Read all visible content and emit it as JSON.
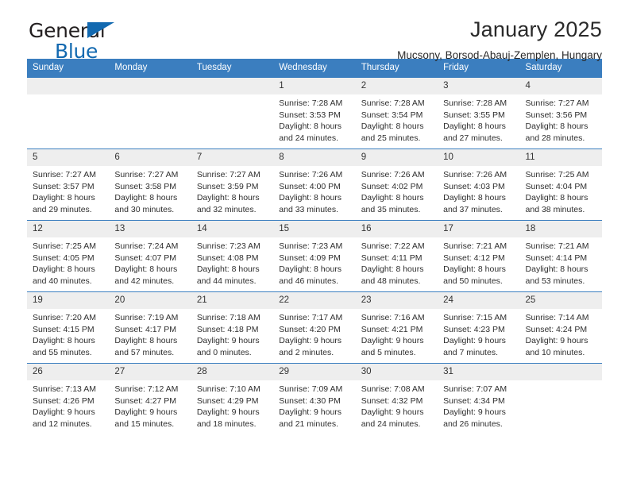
{
  "brand": {
    "line1": "General",
    "line2": "Blue",
    "accent_color": "#1269b0",
    "triangle_icon": "blue-triangle-icon"
  },
  "header": {
    "title": "January 2025",
    "location": "Mucsony, Borsod-Abauj-Zemplen, Hungary"
  },
  "theme": {
    "header_blue": "#3b7ebf",
    "daynum_band": "#eeeeee",
    "text": "#2e2e2e"
  },
  "weekday_headers": [
    "Sunday",
    "Monday",
    "Tuesday",
    "Wednesday",
    "Thursday",
    "Friday",
    "Saturday"
  ],
  "weeks": [
    [
      {
        "day": "",
        "empty": true,
        "sunrise": "",
        "sunset": "",
        "daylight_line1": "",
        "daylight_line2": ""
      },
      {
        "day": "",
        "empty": true,
        "sunrise": "",
        "sunset": "",
        "daylight_line1": "",
        "daylight_line2": ""
      },
      {
        "day": "",
        "empty": true,
        "sunrise": "",
        "sunset": "",
        "daylight_line1": "",
        "daylight_line2": ""
      },
      {
        "day": "1",
        "sunrise": "Sunrise: 7:28 AM",
        "sunset": "Sunset: 3:53 PM",
        "daylight_line1": "Daylight: 8 hours",
        "daylight_line2": "and 24 minutes."
      },
      {
        "day": "2",
        "sunrise": "Sunrise: 7:28 AM",
        "sunset": "Sunset: 3:54 PM",
        "daylight_line1": "Daylight: 8 hours",
        "daylight_line2": "and 25 minutes."
      },
      {
        "day": "3",
        "sunrise": "Sunrise: 7:28 AM",
        "sunset": "Sunset: 3:55 PM",
        "daylight_line1": "Daylight: 8 hours",
        "daylight_line2": "and 27 minutes."
      },
      {
        "day": "4",
        "sunrise": "Sunrise: 7:27 AM",
        "sunset": "Sunset: 3:56 PM",
        "daylight_line1": "Daylight: 8 hours",
        "daylight_line2": "and 28 minutes."
      }
    ],
    [
      {
        "day": "5",
        "sunrise": "Sunrise: 7:27 AM",
        "sunset": "Sunset: 3:57 PM",
        "daylight_line1": "Daylight: 8 hours",
        "daylight_line2": "and 29 minutes."
      },
      {
        "day": "6",
        "sunrise": "Sunrise: 7:27 AM",
        "sunset": "Sunset: 3:58 PM",
        "daylight_line1": "Daylight: 8 hours",
        "daylight_line2": "and 30 minutes."
      },
      {
        "day": "7",
        "sunrise": "Sunrise: 7:27 AM",
        "sunset": "Sunset: 3:59 PM",
        "daylight_line1": "Daylight: 8 hours",
        "daylight_line2": "and 32 minutes."
      },
      {
        "day": "8",
        "sunrise": "Sunrise: 7:26 AM",
        "sunset": "Sunset: 4:00 PM",
        "daylight_line1": "Daylight: 8 hours",
        "daylight_line2": "and 33 minutes."
      },
      {
        "day": "9",
        "sunrise": "Sunrise: 7:26 AM",
        "sunset": "Sunset: 4:02 PM",
        "daylight_line1": "Daylight: 8 hours",
        "daylight_line2": "and 35 minutes."
      },
      {
        "day": "10",
        "sunrise": "Sunrise: 7:26 AM",
        "sunset": "Sunset: 4:03 PM",
        "daylight_line1": "Daylight: 8 hours",
        "daylight_line2": "and 37 minutes."
      },
      {
        "day": "11",
        "sunrise": "Sunrise: 7:25 AM",
        "sunset": "Sunset: 4:04 PM",
        "daylight_line1": "Daylight: 8 hours",
        "daylight_line2": "and 38 minutes."
      }
    ],
    [
      {
        "day": "12",
        "sunrise": "Sunrise: 7:25 AM",
        "sunset": "Sunset: 4:05 PM",
        "daylight_line1": "Daylight: 8 hours",
        "daylight_line2": "and 40 minutes."
      },
      {
        "day": "13",
        "sunrise": "Sunrise: 7:24 AM",
        "sunset": "Sunset: 4:07 PM",
        "daylight_line1": "Daylight: 8 hours",
        "daylight_line2": "and 42 minutes."
      },
      {
        "day": "14",
        "sunrise": "Sunrise: 7:23 AM",
        "sunset": "Sunset: 4:08 PM",
        "daylight_line1": "Daylight: 8 hours",
        "daylight_line2": "and 44 minutes."
      },
      {
        "day": "15",
        "sunrise": "Sunrise: 7:23 AM",
        "sunset": "Sunset: 4:09 PM",
        "daylight_line1": "Daylight: 8 hours",
        "daylight_line2": "and 46 minutes."
      },
      {
        "day": "16",
        "sunrise": "Sunrise: 7:22 AM",
        "sunset": "Sunset: 4:11 PM",
        "daylight_line1": "Daylight: 8 hours",
        "daylight_line2": "and 48 minutes."
      },
      {
        "day": "17",
        "sunrise": "Sunrise: 7:21 AM",
        "sunset": "Sunset: 4:12 PM",
        "daylight_line1": "Daylight: 8 hours",
        "daylight_line2": "and 50 minutes."
      },
      {
        "day": "18",
        "sunrise": "Sunrise: 7:21 AM",
        "sunset": "Sunset: 4:14 PM",
        "daylight_line1": "Daylight: 8 hours",
        "daylight_line2": "and 53 minutes."
      }
    ],
    [
      {
        "day": "19",
        "sunrise": "Sunrise: 7:20 AM",
        "sunset": "Sunset: 4:15 PM",
        "daylight_line1": "Daylight: 8 hours",
        "daylight_line2": "and 55 minutes."
      },
      {
        "day": "20",
        "sunrise": "Sunrise: 7:19 AM",
        "sunset": "Sunset: 4:17 PM",
        "daylight_line1": "Daylight: 8 hours",
        "daylight_line2": "and 57 minutes."
      },
      {
        "day": "21",
        "sunrise": "Sunrise: 7:18 AM",
        "sunset": "Sunset: 4:18 PM",
        "daylight_line1": "Daylight: 9 hours",
        "daylight_line2": "and 0 minutes."
      },
      {
        "day": "22",
        "sunrise": "Sunrise: 7:17 AM",
        "sunset": "Sunset: 4:20 PM",
        "daylight_line1": "Daylight: 9 hours",
        "daylight_line2": "and 2 minutes."
      },
      {
        "day": "23",
        "sunrise": "Sunrise: 7:16 AM",
        "sunset": "Sunset: 4:21 PM",
        "daylight_line1": "Daylight: 9 hours",
        "daylight_line2": "and 5 minutes."
      },
      {
        "day": "24",
        "sunrise": "Sunrise: 7:15 AM",
        "sunset": "Sunset: 4:23 PM",
        "daylight_line1": "Daylight: 9 hours",
        "daylight_line2": "and 7 minutes."
      },
      {
        "day": "25",
        "sunrise": "Sunrise: 7:14 AM",
        "sunset": "Sunset: 4:24 PM",
        "daylight_line1": "Daylight: 9 hours",
        "daylight_line2": "and 10 minutes."
      }
    ],
    [
      {
        "day": "26",
        "sunrise": "Sunrise: 7:13 AM",
        "sunset": "Sunset: 4:26 PM",
        "daylight_line1": "Daylight: 9 hours",
        "daylight_line2": "and 12 minutes."
      },
      {
        "day": "27",
        "sunrise": "Sunrise: 7:12 AM",
        "sunset": "Sunset: 4:27 PM",
        "daylight_line1": "Daylight: 9 hours",
        "daylight_line2": "and 15 minutes."
      },
      {
        "day": "28",
        "sunrise": "Sunrise: 7:10 AM",
        "sunset": "Sunset: 4:29 PM",
        "daylight_line1": "Daylight: 9 hours",
        "daylight_line2": "and 18 minutes."
      },
      {
        "day": "29",
        "sunrise": "Sunrise: 7:09 AM",
        "sunset": "Sunset: 4:30 PM",
        "daylight_line1": "Daylight: 9 hours",
        "daylight_line2": "and 21 minutes."
      },
      {
        "day": "30",
        "sunrise": "Sunrise: 7:08 AM",
        "sunset": "Sunset: 4:32 PM",
        "daylight_line1": "Daylight: 9 hours",
        "daylight_line2": "and 24 minutes."
      },
      {
        "day": "31",
        "sunrise": "Sunrise: 7:07 AM",
        "sunset": "Sunset: 4:34 PM",
        "daylight_line1": "Daylight: 9 hours",
        "daylight_line2": "and 26 minutes."
      },
      {
        "day": "",
        "empty": true,
        "sunrise": "",
        "sunset": "",
        "daylight_line1": "",
        "daylight_line2": ""
      }
    ]
  ]
}
